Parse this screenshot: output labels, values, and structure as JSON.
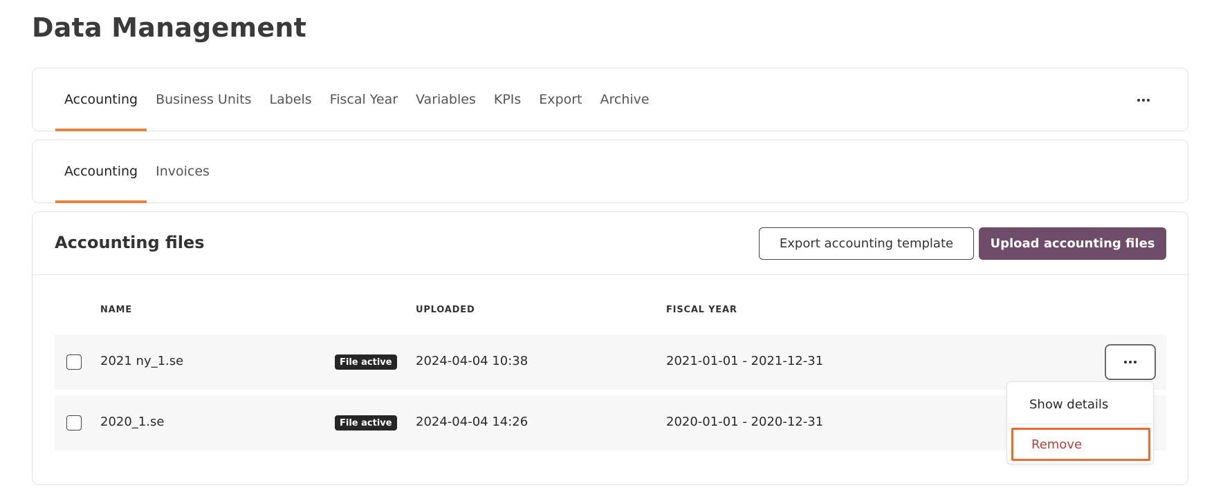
{
  "page": {
    "title": "Data Management"
  },
  "main_tabs": [
    {
      "label": "Accounting",
      "active": true
    },
    {
      "label": "Business Units",
      "active": false
    },
    {
      "label": "Labels",
      "active": false
    },
    {
      "label": "Fiscal Year",
      "active": false
    },
    {
      "label": "Variables",
      "active": false
    },
    {
      "label": "KPIs",
      "active": false
    },
    {
      "label": "Export",
      "active": false
    },
    {
      "label": "Archive",
      "active": false
    }
  ],
  "sub_tabs": [
    {
      "label": "Accounting",
      "active": true
    },
    {
      "label": "Invoices",
      "active": false
    }
  ],
  "files": {
    "title": "Accounting files",
    "export_button": "Export accounting template",
    "upload_button": "Upload accounting files",
    "columns": {
      "name": "NAME",
      "uploaded": "UPLOADED",
      "fiscal_year": "FISCAL YEAR"
    },
    "rows": [
      {
        "name": "2021 ny_1.se",
        "status": "File active",
        "uploaded": "2024-04-04 10:38",
        "fiscal_year": "2021-01-01 - 2021-12-31"
      },
      {
        "name": "2020_1.se",
        "status": "File active",
        "uploaded": "2024-04-04 14:26",
        "fiscal_year": "2020-01-01 - 2020-12-31"
      }
    ]
  },
  "row_menu": {
    "show_details": "Show details",
    "remove": "Remove"
  },
  "colors": {
    "accent": "#e8823f",
    "primary": "#6f4c6a",
    "danger": "#b0413e",
    "highlight": "#ea6a2a"
  },
  "icons": {
    "more": "more-horizontal-icon"
  }
}
